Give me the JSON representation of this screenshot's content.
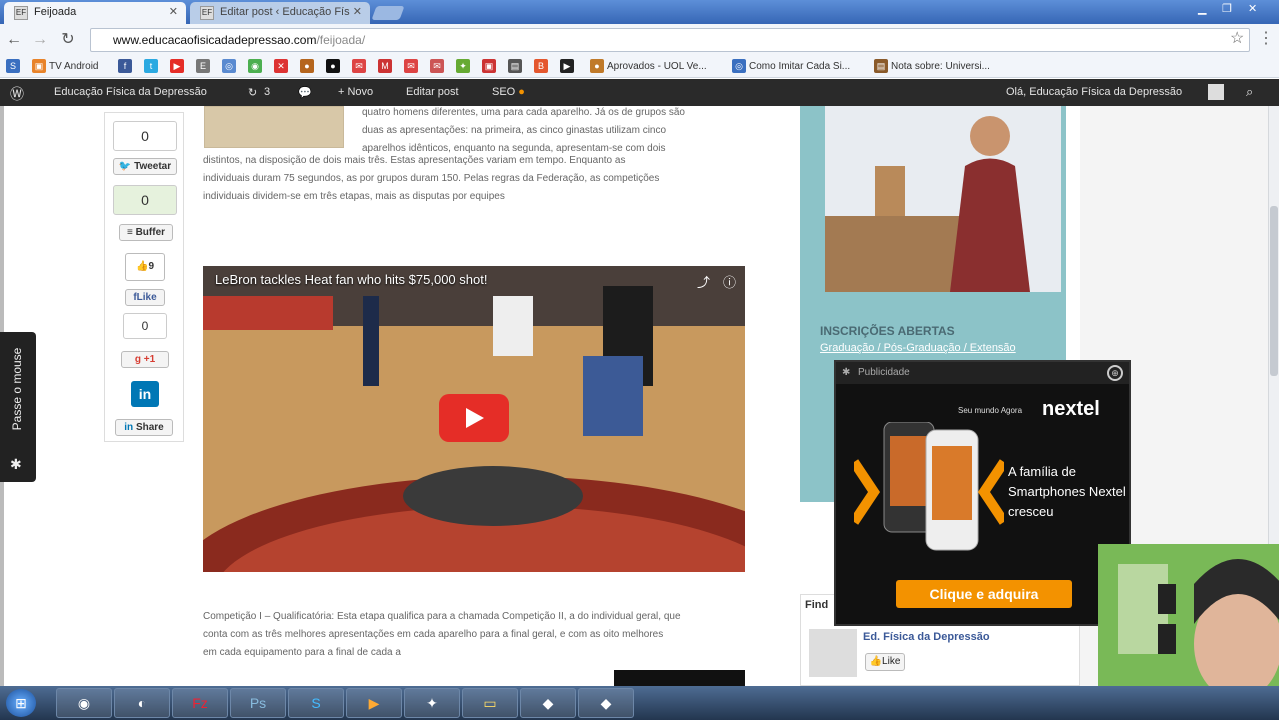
{
  "browser": {
    "tabs": [
      {
        "label": "Feijoada",
        "active": true
      },
      {
        "label": "Editar post ‹ Educação Fís",
        "active": false
      }
    ],
    "url_domain": "www.educacaofisicadadepressao.com",
    "url_path": "/feijoada/",
    "bookmarks": [
      {
        "label": "TV Android",
        "icon": "android-icon",
        "color": "#e8832a"
      },
      {
        "label": "Aprovados - UOL Ve...",
        "icon": "uol-icon",
        "color": "#c07a2a"
      },
      {
        "label": "Como Imitar Cada Si...",
        "icon": "globe-icon",
        "color": "#3a6fc0"
      },
      {
        "label": "Nota sobre: Universi...",
        "icon": "doc-icon",
        "color": "#8a5a2a"
      }
    ]
  },
  "wpbar": {
    "site_name": "Educação Física da Depressão",
    "updates": "3",
    "new_label": "+ Novo",
    "edit_label": "Editar post",
    "seo_label": "SEO",
    "greeting": "Olá, Educação Física da Depressão"
  },
  "share": {
    "tweet_count": "0",
    "tweet_label": "Tweetar",
    "buffer_count": "0",
    "buffer_label": "Buffer",
    "like_count": "9",
    "like_label": "Like",
    "gplus_count": "0",
    "gplus_label": "+1",
    "linkedin_label": "in",
    "share_label": "Share"
  },
  "article": {
    "para1_line0": "quatro homens diferentes, uma para cada aparelho. Já os de grupos são",
    "para1_line1": "duas as apresentações: na primeira, as cinco ginastas utilizam cinco",
    "para1_line2": "aparelhos idênticos, enquanto na segunda, apresentam-se com dois",
    "para1_line3": "distintos, na disposição de dois mais três. Estas apresentações variam em tempo. Enquanto as",
    "para1_line4": "individuais duram 75 segundos, as por grupos duram 150. Pelas regras da Federação, as competições",
    "para1_line5": "individuais dividem-se em três etapas, mais as disputas por equipes",
    "video_title": "LeBron tackles Heat fan who hits $75,000 shot!",
    "para2_line0": "Competição I – Qualificatória: Esta etapa qualifica para a chamada Competição II, a do individual geral, que",
    "para2_line1": "conta com as três melhores apresentações em cada aparelho para a final geral, e com as oito melhores",
    "para2_line2": "em cada equipamento para a final de cada a"
  },
  "sidebar": {
    "inscricoes": "INSCRIÇÕES ABERTAS",
    "links": "Graduação / Pós-Graduação / Extensão",
    "find_label": "Find",
    "fb_page": "Ed. Física da Depressão",
    "fb_like": "Like"
  },
  "ad": {
    "header": "Publicidade",
    "tagline": "Seu mundo Agora",
    "brand": "nextel",
    "text": "A família de Smartphones Nextel cresceu",
    "cta": "Clique e adquira"
  },
  "passe": {
    "label": "Passe o mouse"
  },
  "colors": {
    "tab_bar": "#3666b5",
    "wp_bar": "#2a2a2a",
    "sidebar_teal": "#8cc3c8",
    "ad_orange": "#f39200",
    "youtube_red": "#e52d27"
  }
}
